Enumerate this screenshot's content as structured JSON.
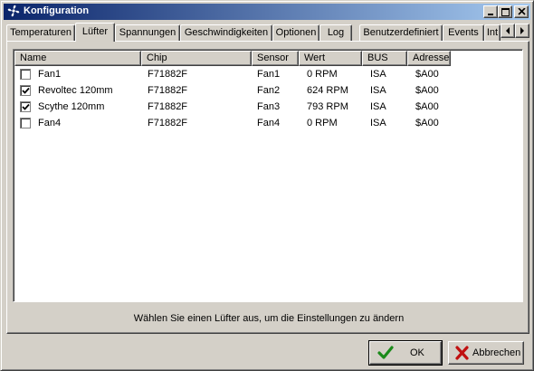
{
  "window": {
    "title": "Konfiguration"
  },
  "tabs": [
    {
      "label": "Temperaturen",
      "active": false
    },
    {
      "label": "Lüfter",
      "active": true
    },
    {
      "label": "Spannungen",
      "active": false
    },
    {
      "label": "Geschwindigkeiten",
      "active": false
    },
    {
      "label": "Optionen",
      "active": false
    },
    {
      "label": "Log",
      "active": false
    },
    {
      "label": "Benutzerdefiniert",
      "active": false
    },
    {
      "label": "Events",
      "active": false
    },
    {
      "label": "Int",
      "active": false
    }
  ],
  "list": {
    "columns": [
      "Name",
      "Chip",
      "Sensor",
      "Wert",
      "BUS",
      "Adresse"
    ],
    "rows": [
      {
        "checked": false,
        "name": "Fan1",
        "chip": "F71882F",
        "sensor": "Fan1",
        "value": "0 RPM",
        "bus": "ISA",
        "address": "$A00"
      },
      {
        "checked": true,
        "name": "Revoltec 120mm",
        "chip": "F71882F",
        "sensor": "Fan2",
        "value": "624 RPM",
        "bus": "ISA",
        "address": "$A00"
      },
      {
        "checked": true,
        "name": "Scythe 120mm",
        "chip": "F71882F",
        "sensor": "Fan3",
        "value": "793 RPM",
        "bus": "ISA",
        "address": "$A00"
      },
      {
        "checked": false,
        "name": "Fan4",
        "chip": "F71882F",
        "sensor": "Fan4",
        "value": "0 RPM",
        "bus": "ISA",
        "address": "$A00"
      }
    ]
  },
  "hint": "Wählen Sie einen Lüfter aus, um die Einstellungen zu ändern",
  "buttons": {
    "ok": "OK",
    "cancel": "Abbrechen"
  },
  "icons": {
    "app": "fan-icon",
    "minimize": "minimize-icon",
    "maximize": "maximize-icon",
    "close": "close-icon",
    "tab_left": "arrow-left-icon",
    "tab_right": "arrow-right-icon",
    "ok": "checkmark-icon",
    "cancel": "x-icon"
  },
  "colors": {
    "title_start": "#0a246a",
    "title_end": "#a6caf0",
    "face": "#d4d0c8",
    "ok_icon": "#1a8a1a",
    "cancel_icon": "#c01010"
  }
}
